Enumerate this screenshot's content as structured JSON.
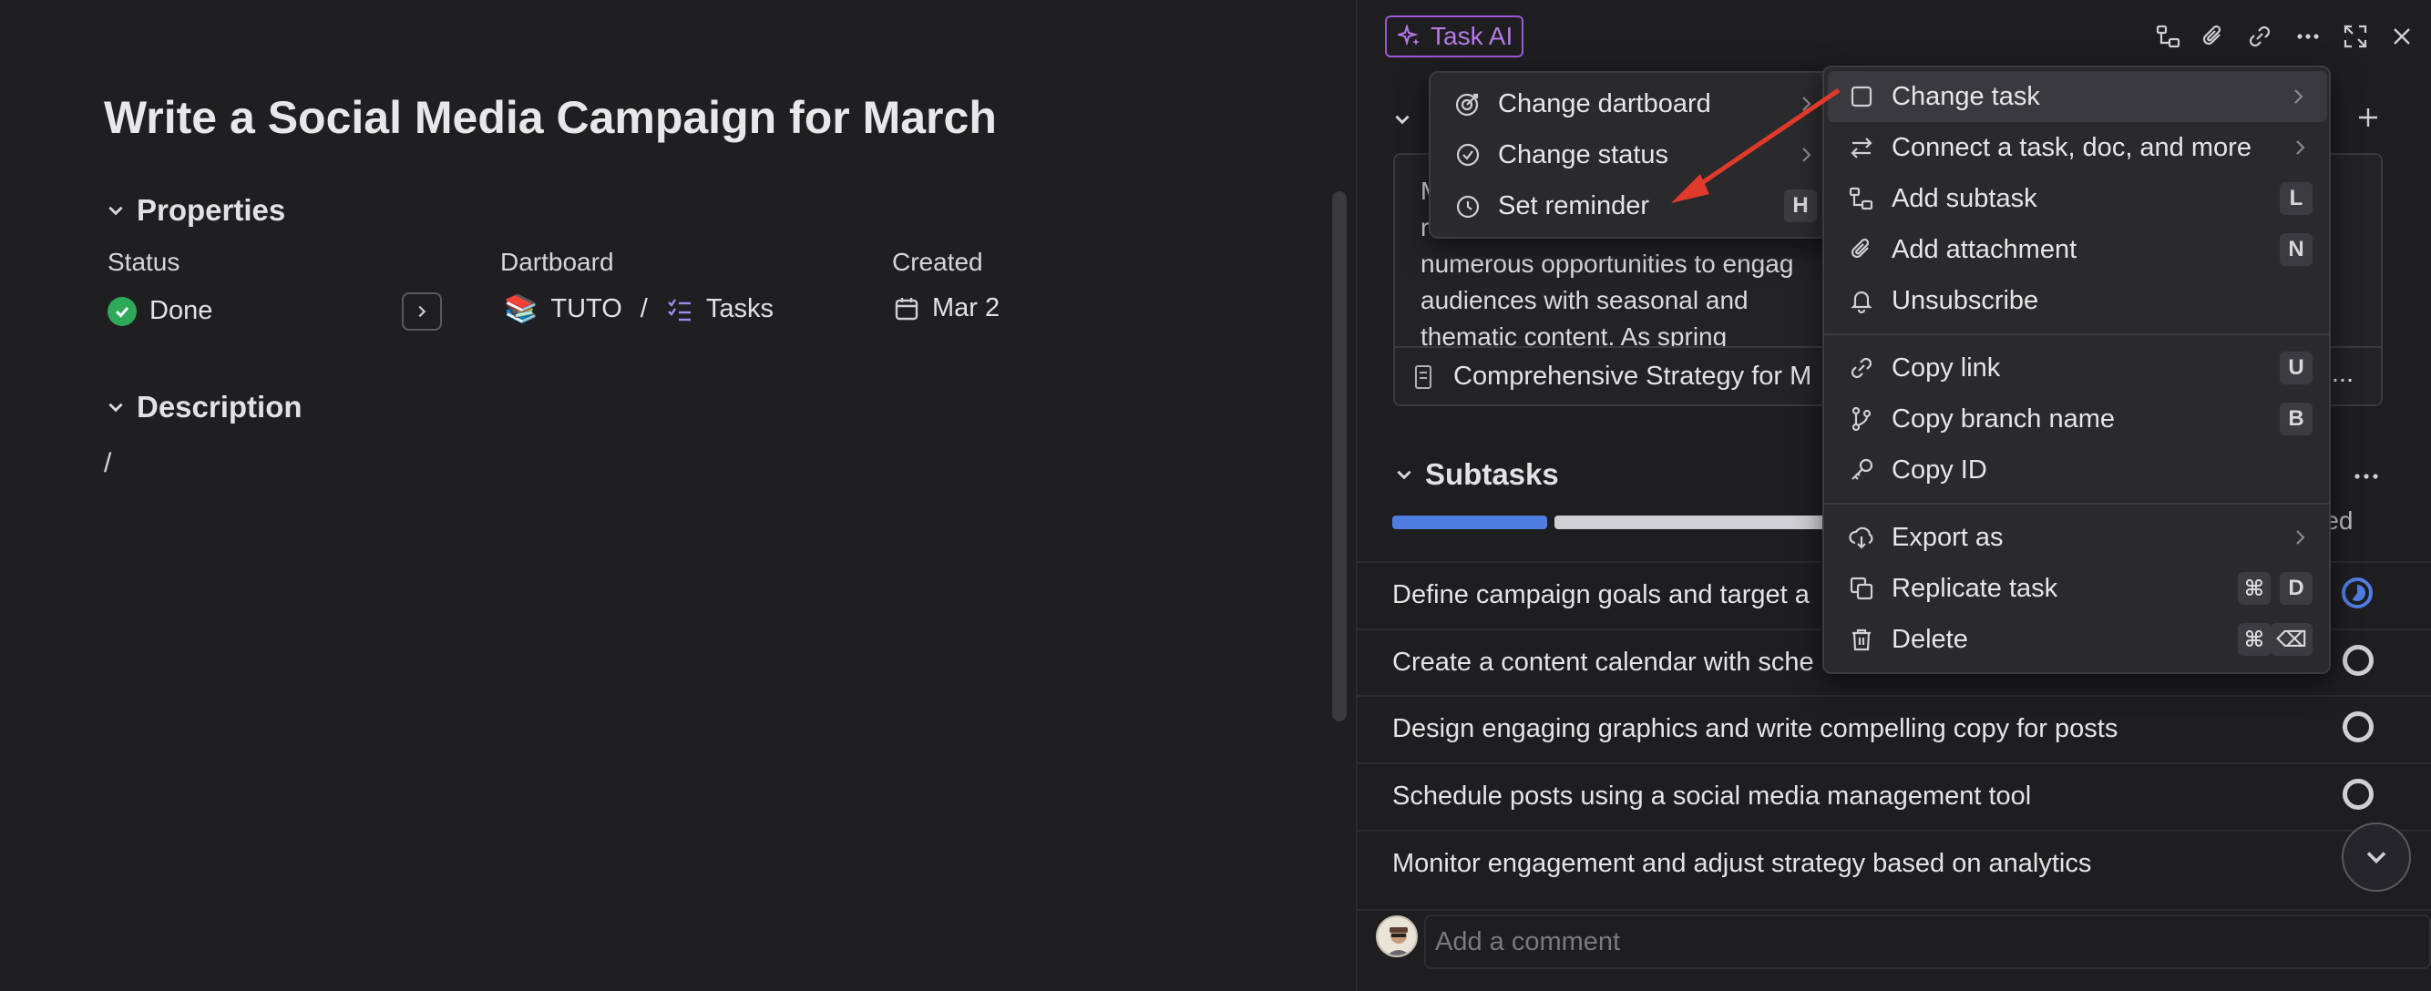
{
  "task": {
    "title": "Write a Social Media Campaign for March"
  },
  "properties": {
    "header": "Properties",
    "status_label": "Status",
    "status_value": "Done",
    "dartboard_label": "Dartboard",
    "dartboard_emoji": "📚",
    "dartboard_value": "TUTO",
    "dartboard_sep": "/",
    "dartboard_sub": "Tasks",
    "created_label": "Created",
    "created_value": "Mar 2"
  },
  "description": {
    "header": "Description",
    "content": "/"
  },
  "right_panel": {
    "task_ai_label": "Task AI",
    "doc_text_l1": "M",
    "doc_text_l2": "r",
    "doc_text_l3": "numerous opportunities to engag",
    "doc_text_l4": "audiences with seasonal and",
    "doc_text_l5": "thematic content. As spring",
    "doc_footer_title": "Comprehensive Strategy for M",
    "doc_footer_more": "...",
    "subtasks_header": "Subtasks",
    "subtasks_completed_partial": "eted",
    "subtasks": [
      "Define campaign goals and target a",
      "Create a content calendar with sche",
      "Design engaging graphics and write compelling copy for posts",
      "Schedule posts using a social media management tool",
      "Monitor engagement and adjust strategy based on analytics"
    ],
    "comment_placeholder": "Add a comment"
  },
  "submenu": {
    "items": [
      {
        "label": "Change dartboard"
      },
      {
        "label": "Change status"
      },
      {
        "label": "Set reminder",
        "shortcut": "H"
      }
    ]
  },
  "main_menu": {
    "items": [
      {
        "label": "Change task"
      },
      {
        "label": "Connect a task, doc, and more"
      },
      {
        "label": "Add subtask",
        "shortcut": "L"
      },
      {
        "label": "Add attachment",
        "shortcut": "N"
      },
      {
        "label": "Unsubscribe"
      },
      {
        "label": "Copy link",
        "shortcut": "U"
      },
      {
        "label": "Copy branch name",
        "shortcut": "B"
      },
      {
        "label": "Copy ID"
      },
      {
        "label": "Export as"
      },
      {
        "label": "Replicate task",
        "shortcut_mod": "⌘",
        "shortcut": "D"
      },
      {
        "label": "Delete",
        "shortcut_mod": "⌘",
        "shortcut": "⌫"
      }
    ]
  },
  "colors": {
    "accent_purple": "#9b59d9",
    "done_green": "#2ea95a",
    "progress_blue": "#4f7de0",
    "annotation_red": "#e03a2a"
  }
}
